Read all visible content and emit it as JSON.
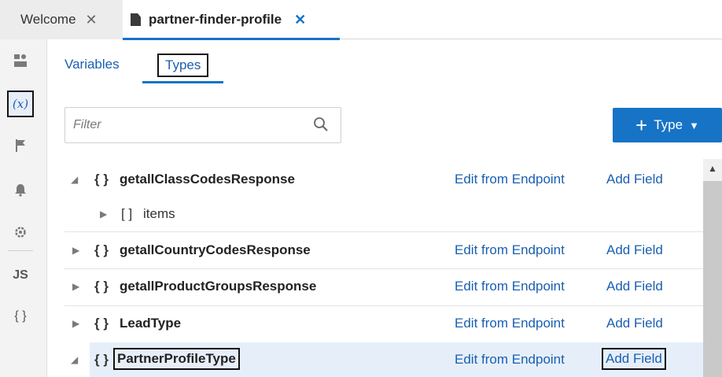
{
  "tabs": {
    "welcome": {
      "label": "Welcome",
      "close": "✕"
    },
    "active": {
      "label": "partner-finder-profile",
      "close": "✕"
    }
  },
  "rail": {
    "variables_icon_text": "(x)",
    "js_text": "JS",
    "braces_text": "{ }",
    "icons": [
      "panel-icon",
      "variables-icon",
      "flag-icon",
      "bell-icon",
      "gear-icon",
      "js-icon",
      "braces-icon"
    ]
  },
  "subtabs": {
    "variables": "Variables",
    "types": "Types"
  },
  "filter": {
    "placeholder": "Filter"
  },
  "type_button": {
    "plus": "+",
    "label": "Type",
    "caret": "▼"
  },
  "rows": [
    {
      "toggle": "◢",
      "braces": "{ }",
      "name": "getallClassCodesResponse",
      "edit": "Edit from Endpoint",
      "add": "Add Field"
    },
    {
      "toggle": "▶",
      "braces": "[ ]",
      "name": "items"
    },
    {
      "toggle": "▶",
      "braces": "{ }",
      "name": "getallCountryCodesResponse",
      "edit": "Edit from Endpoint",
      "add": "Add Field"
    },
    {
      "toggle": "▶",
      "braces": "{ }",
      "name": "getallProductGroupsResponse",
      "edit": "Edit from Endpoint",
      "add": "Add Field"
    },
    {
      "toggle": "▶",
      "braces": "{ }",
      "name": "LeadType",
      "edit": "Edit from Endpoint",
      "add": "Add Field"
    },
    {
      "toggle": "◢",
      "braces": "{ }",
      "name": "PartnerProfileType",
      "edit": "Edit from Endpoint",
      "add": "Add Field"
    }
  ],
  "scrollbar": {
    "up": "▲"
  },
  "colors": {
    "accent": "#1673c6",
    "link": "#1a5fb0",
    "selected_row": "#e6eff9"
  }
}
